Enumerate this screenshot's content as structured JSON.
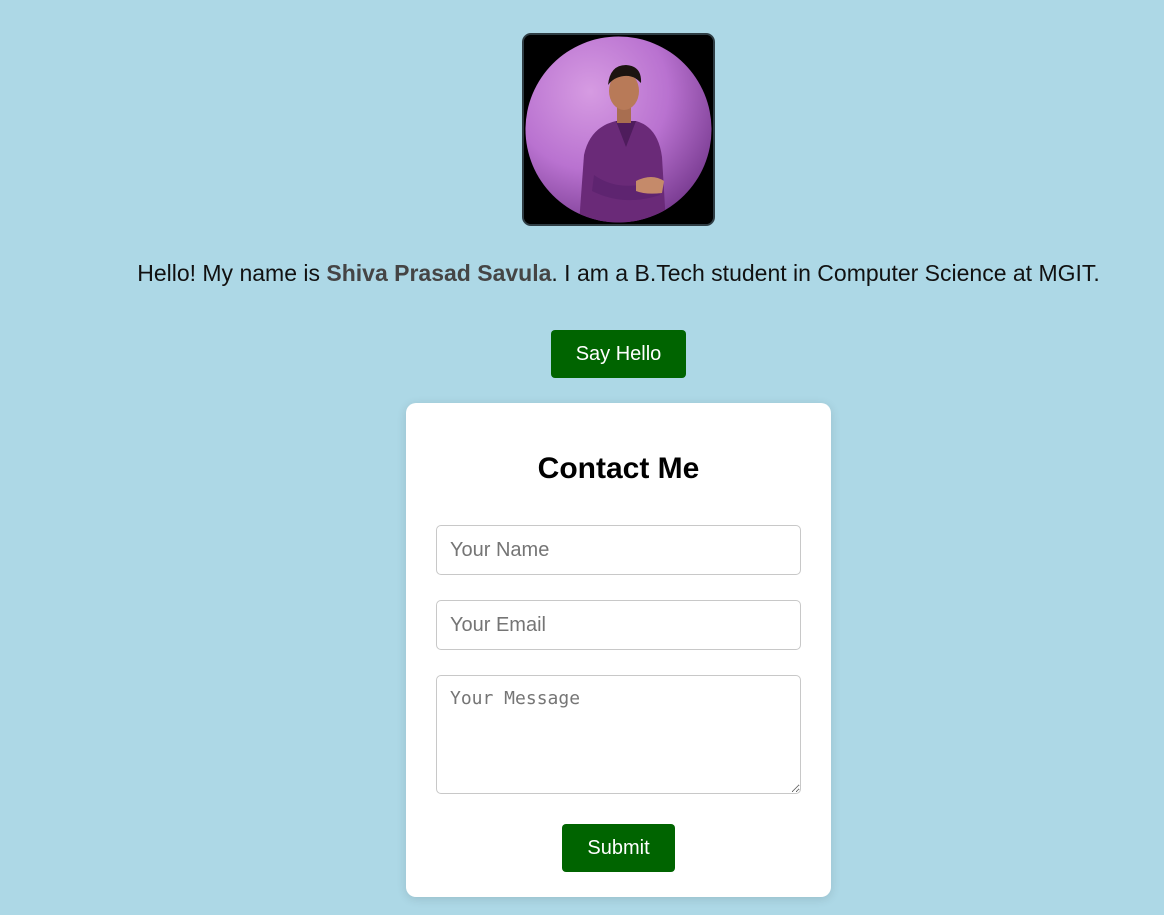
{
  "profile": {
    "photo_alt": "profile photo",
    "intro_prefix": "Hello! My name is ",
    "name": "Shiva Prasad Savula",
    "intro_suffix": ". I am a B.Tech student in Computer Science at MGIT."
  },
  "actions": {
    "say_hello_label": "Say Hello"
  },
  "contact": {
    "title": "Contact Me",
    "name_placeholder": "Your Name",
    "email_placeholder": "Your Email",
    "message_placeholder": "Your Message",
    "submit_label": "Submit"
  },
  "colors": {
    "page_background": "#add8e6",
    "button_green": "#006400",
    "card_background": "#ffffff"
  }
}
